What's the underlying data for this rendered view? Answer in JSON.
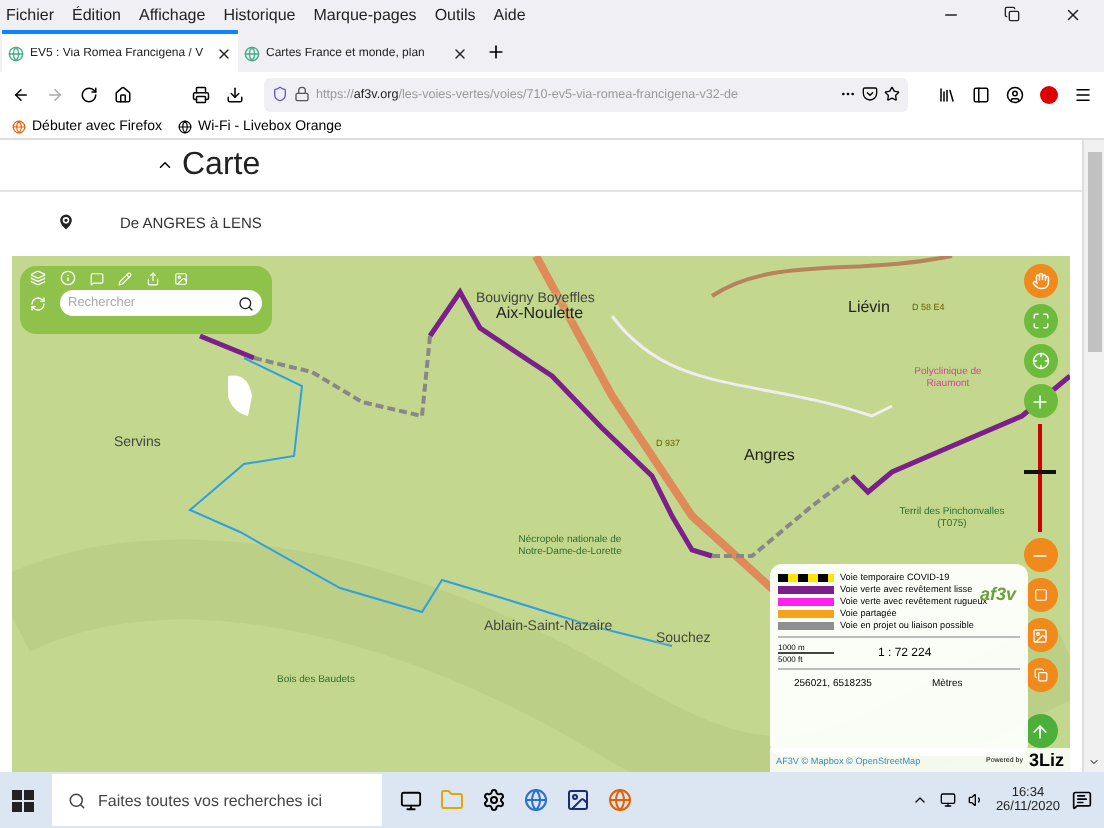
{
  "menu_bar": [
    "Fichier",
    "Édition",
    "Affichage",
    "Historique",
    "Marque-pages",
    "Outils",
    "Aide"
  ],
  "tabs": [
    {
      "title": "EV5 : Via Romea Francigena / V",
      "selected": true
    },
    {
      "title": "Cartes France et monde, plan",
      "selected": false
    }
  ],
  "address_bar": {
    "scheme": "https://",
    "host": "af3v.org",
    "path": "/les-voies-vertes/voies/710-ev5-via-romea-francigena-v32-de"
  },
  "bookmarks": [
    "Débuter avec Firefox",
    "Wi-Fi - Livebox Orange"
  ],
  "section": {
    "title": "Carte",
    "expanded": true
  },
  "route": "De ANGRES à LENS",
  "map": {
    "search": {
      "placeholder": "Rechercher"
    },
    "labels": [
      {
        "text": "Bouvigny Boyeffles",
        "kind": "town"
      },
      {
        "text": "Aix-Noulette",
        "kind": "city"
      },
      {
        "text": "Liévin",
        "kind": "city"
      },
      {
        "text": "Servins",
        "kind": "town"
      },
      {
        "text": "Angres",
        "kind": "city"
      },
      {
        "text": "Polyclinique de Riaumont",
        "kind": "poi"
      },
      {
        "text": "Nécropole nationale de Notre-Dame-de-Lorette",
        "kind": "park"
      },
      {
        "text": "Ablain-Saint-Nazaire",
        "kind": "town"
      },
      {
        "text": "Souchez",
        "kind": "town"
      },
      {
        "text": "Bois des Baudets",
        "kind": "park"
      },
      {
        "text": "Terril des Pinchonvalles (T075)",
        "kind": "park"
      },
      {
        "text": "D 937",
        "kind": "road"
      },
      {
        "text": "D 58 E4",
        "kind": "road"
      }
    ],
    "zoom": {
      "level": 0.55
    },
    "legend": [
      {
        "label": "Voie temporaire COVID-19",
        "color": "#000000",
        "kind": "dashed"
      },
      {
        "label": "Voie verte avec revêtement lisse",
        "color": "#7b1f8a",
        "kind": "solid"
      },
      {
        "label": "Voie verte avec revêtement rugueux",
        "color": "#ff22ee",
        "kind": "solid"
      },
      {
        "label": "Voie partagée",
        "color": "#f7a21b",
        "kind": "solid"
      },
      {
        "label": "Voie en projet ou liaison possible",
        "color": "#8f8f8f",
        "kind": "solid"
      }
    ],
    "logo": "af3v",
    "scale": {
      "metric": "1000 m",
      "imperial": "5000 ft",
      "ratio": "1 : 72 224"
    },
    "coordinates": "256021, 6518235",
    "units": "Mètres",
    "attribution": "AF3V © Mapbox © OpenStreetMap",
    "powered_by": "Powered by",
    "brand": "3Liz"
  },
  "taskbar": {
    "search": {
      "placeholder": "Faites toutes vos recherches ici"
    },
    "time": "16:34",
    "date": "26/11/2020"
  }
}
